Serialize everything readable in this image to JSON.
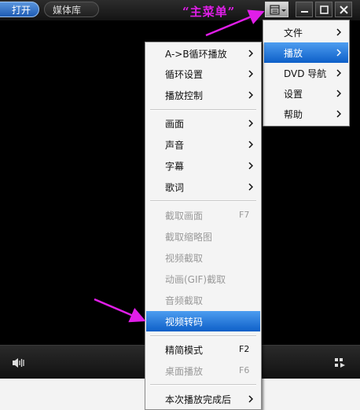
{
  "titlebar": {
    "open_tab": "打开",
    "library_tab": "媒体库"
  },
  "annotation": {
    "main_menu_label": "“主菜单”",
    "arrow_color": "#e01ee8"
  },
  "icons": {
    "main_menu": "main-menu-icon",
    "minimize": "minimize-icon",
    "maximize": "maximize-icon",
    "close": "close-icon",
    "volume": "speaker-icon",
    "playlist": "playlist-icon",
    "submenu": "chevron-right-icon"
  },
  "main_menu": {
    "items": [
      {
        "label": "文件"
      },
      {
        "label": "播放"
      },
      {
        "label": "DVD 导航"
      },
      {
        "label": "设置"
      },
      {
        "label": "帮助"
      }
    ]
  },
  "play_menu": {
    "items": [
      {
        "label": "A->B循环播放"
      },
      {
        "label": "循环设置"
      },
      {
        "label": "播放控制"
      },
      {
        "label": "画面"
      },
      {
        "label": "声音"
      },
      {
        "label": "字幕"
      },
      {
        "label": "歌词"
      },
      {
        "label": "截取画面",
        "shortcut": "F7"
      },
      {
        "label": "截取缩略图"
      },
      {
        "label": "视频截取"
      },
      {
        "label": "动画(GIF)截取"
      },
      {
        "label": "音频截取"
      },
      {
        "label": "视频转码"
      },
      {
        "label": "精简模式",
        "shortcut": "F2"
      },
      {
        "label": "桌面播放",
        "shortcut": "F6"
      },
      {
        "label": "本次播放完成后"
      }
    ]
  },
  "colors": {
    "highlight": "#1a6fd6",
    "annotation": "#e01ee8"
  }
}
